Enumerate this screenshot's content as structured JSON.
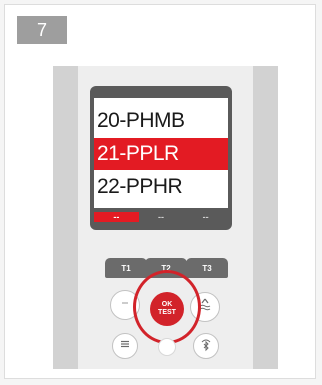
{
  "step": {
    "number": "7"
  },
  "screen": {
    "rows": [
      {
        "label": "20-PHMB",
        "selected": false
      },
      {
        "label": "21-PPLR",
        "selected": true
      },
      {
        "label": "22-PPHR",
        "selected": false
      }
    ],
    "softkeys": [
      "--",
      "--",
      "--"
    ]
  },
  "keypad": {
    "function_keys": [
      "T1",
      "T2",
      "T3"
    ],
    "ok_button": {
      "line1": "OK",
      "line2": "TEST"
    },
    "icons": {
      "left": "minus-icon",
      "right": "up-arrow-waves-icon",
      "menu": "menu-lines-icon",
      "bluetooth": "bluetooth-icon"
    }
  },
  "colors": {
    "highlight": "#e31b23",
    "ok_button": "#d2232a",
    "screen_bezel": "#5a5a5a",
    "function_key": "#6b6b6b"
  }
}
